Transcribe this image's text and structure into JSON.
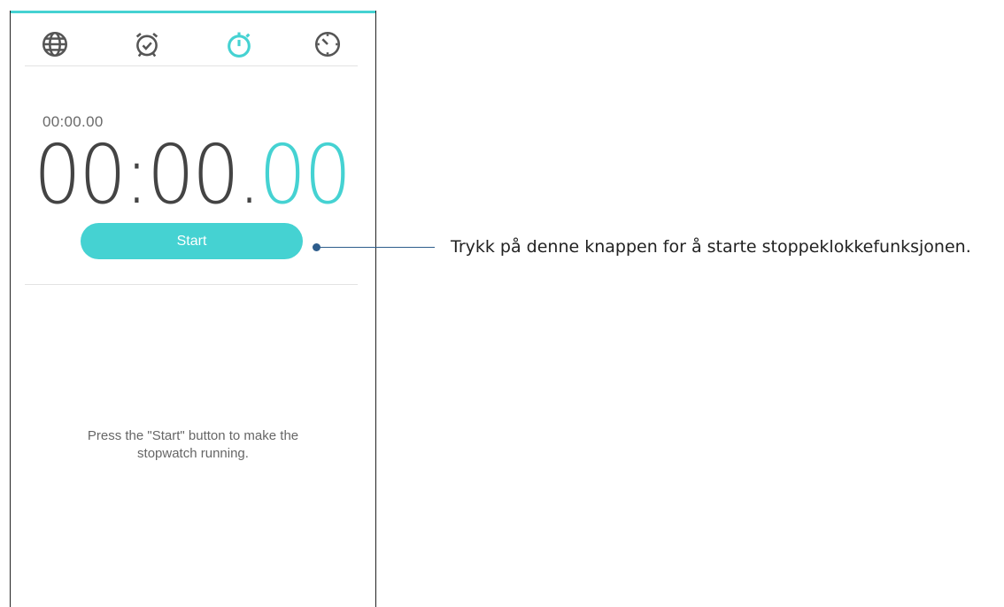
{
  "tabs": [
    {
      "icon": "globe-icon",
      "label": "World Clock"
    },
    {
      "icon": "alarm-icon",
      "label": "Alarm"
    },
    {
      "icon": "stopwatch-icon",
      "label": "Stopwatch",
      "active": true
    },
    {
      "icon": "timer-icon",
      "label": "Timer"
    }
  ],
  "stopwatch": {
    "lap_time": "00:00.00",
    "main_time_big": "00:00.",
    "main_time_hundredths": "00",
    "start_label": "Start",
    "hint_line1": "Press the \"Start\" button to make the",
    "hint_line2": "stopwatch running."
  },
  "callout": {
    "text": "Trykk på denne knappen for å starte stoppeklokkefunksjonen."
  },
  "colors": {
    "accent": "#45d2d2",
    "icon_inactive": "#555555",
    "callout_line": "#2d5d8c"
  }
}
